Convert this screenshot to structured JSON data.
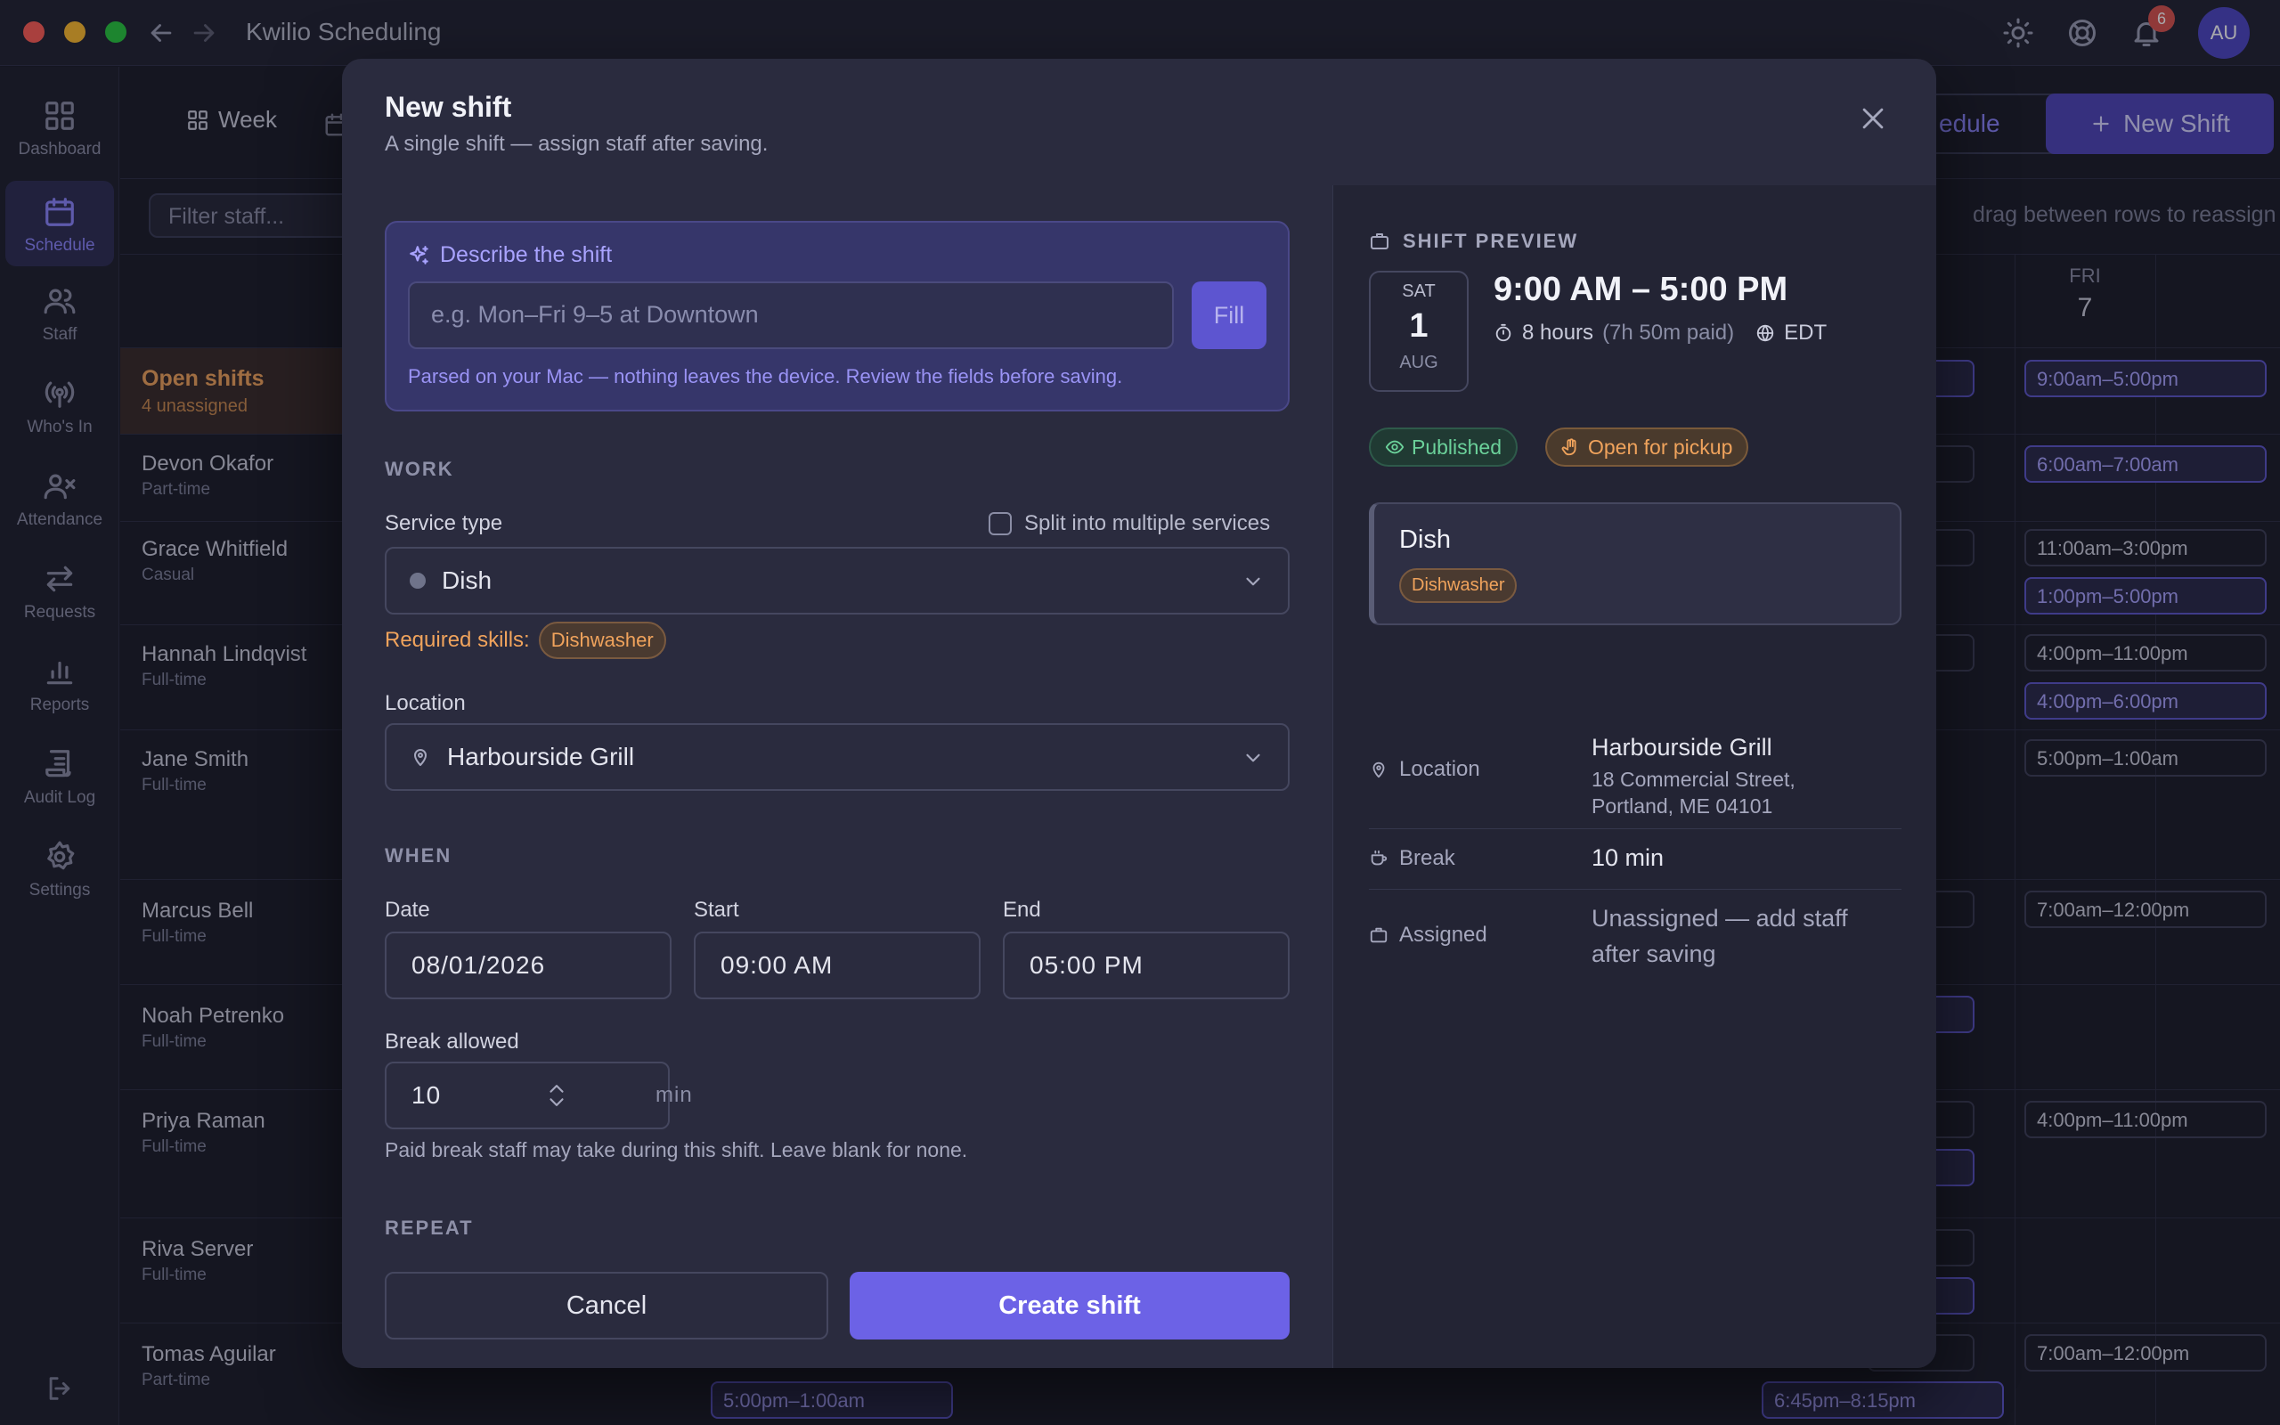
{
  "window": {
    "title": "Kwilio Scheduling",
    "notification_count": "6",
    "avatar_initials": "AU"
  },
  "sidebar": {
    "items": [
      {
        "label": "Dashboard",
        "icon": "grid-icon"
      },
      {
        "label": "Schedule",
        "icon": "calendar-icon",
        "active": true
      },
      {
        "label": "Staff",
        "icon": "users-icon"
      },
      {
        "label": "Who's In",
        "icon": "broadcast-icon"
      },
      {
        "label": "Attendance",
        "icon": "user-x-icon"
      },
      {
        "label": "Requests",
        "icon": "swap-icon"
      },
      {
        "label": "Reports",
        "icon": "bar-chart-icon"
      },
      {
        "label": "Audit Log",
        "icon": "scroll-icon"
      },
      {
        "label": "Settings",
        "icon": "gear-icon"
      }
    ]
  },
  "background": {
    "view_week_label": "Week",
    "publish_label": "edule",
    "new_shift_label": "New Shift",
    "filter_placeholder": "Filter staff...",
    "hint": "drag between rows to reassign",
    "fri_day": "FRI",
    "fri_num": "7",
    "open_shifts": {
      "title": "Open shifts",
      "sub": "4 unassigned"
    },
    "staff": [
      {
        "name": "Devon Okafor",
        "type": "Part-time"
      },
      {
        "name": "Grace Whitfield",
        "type": "Casual"
      },
      {
        "name": "Hannah Lindqvist",
        "type": "Full-time"
      },
      {
        "name": "Jane Smith",
        "type": "Full-time"
      },
      {
        "name": "Marcus Bell",
        "type": "Full-time"
      },
      {
        "name": "Noah Petrenko",
        "type": "Full-time"
      },
      {
        "name": "Priya Raman",
        "type": "Full-time"
      },
      {
        "name": "Riva Server",
        "type": "Full-time"
      },
      {
        "name": "Tomas Aguilar",
        "type": "Part-time"
      }
    ],
    "fri_chips": [
      "9:00am–5:00pm",
      "6:00am–7:00am",
      "11:00am–3:00pm",
      "1:00pm–5:00pm",
      "4:00pm–11:00pm",
      "4:00pm–6:00pm",
      "5:00pm–1:00am",
      "7:00am–12:00pm",
      "4:00pm–11:00pm",
      "7:00am–12:00pm"
    ],
    "thu_chip_text": "m",
    "bottom_chips": [
      "5:00pm–1:00am",
      "6:45pm–8:15pm"
    ]
  },
  "modal": {
    "title": "New shift",
    "subtitle": "A single shift — assign staff after saving.",
    "describe": {
      "heading": "Describe the shift",
      "placeholder": "e.g. Mon–Fri 9–5 at Downtown",
      "fill_label": "Fill",
      "note": "Parsed on your Mac — nothing leaves the device. Review the fields before saving."
    },
    "work_section": "WORK",
    "service_type_label": "Service type",
    "split_label": "Split into multiple services",
    "service_value": "Dish",
    "required_skills_label": "Required skills:",
    "required_skill": "Dishwasher",
    "location_label": "Location",
    "location_value": "Harbourside Grill",
    "when_section": "WHEN",
    "date_label": "Date",
    "date_value": "08/01/2026",
    "start_label": "Start",
    "start_value": "09:00 AM",
    "end_label": "End",
    "end_value": "05:00 PM",
    "break_label": "Break allowed",
    "break_value": "10",
    "break_unit": "min",
    "break_help": "Paid break staff may take during this shift. Leave blank for none.",
    "repeat_section": "REPEAT",
    "cancel_label": "Cancel",
    "create_label": "Create shift"
  },
  "preview": {
    "heading": "SHIFT PREVIEW",
    "dow": "SAT",
    "day": "1",
    "month": "AUG",
    "time_range": "9:00 AM – 5:00 PM",
    "duration": "8 hours",
    "paid": "(7h 50m paid)",
    "timezone": "EDT",
    "status_published": "Published",
    "status_pickup": "Open for pickup",
    "card_title": "Dish",
    "card_skill": "Dishwasher",
    "location_label": "Location",
    "location_name": "Harbourside Grill",
    "location_addr1": "18 Commercial Street,",
    "location_addr2": "Portland, ME 04101",
    "break_label": "Break",
    "break_value": "10 min",
    "assigned_label": "Assigned",
    "assigned_line1": "Unassigned — add staff",
    "assigned_line2": "after saving"
  },
  "colors": {
    "accent": "#6c62e6",
    "published": "#6bd19a",
    "pickup": "#f0a35c",
    "open_shifts": "#f0a35c"
  }
}
